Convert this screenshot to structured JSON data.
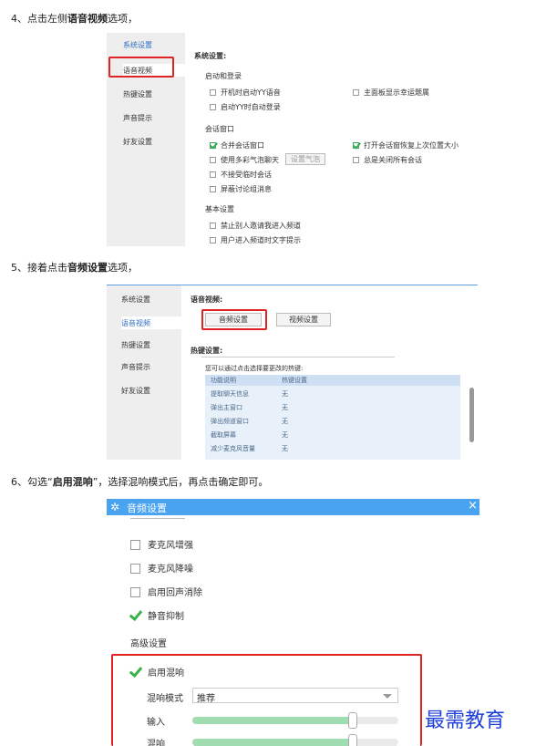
{
  "steps": [
    {
      "prefix": "4、点击左侧",
      "bold": "语音视频",
      "suffix": "选项，"
    },
    {
      "prefix": "5、接着点击",
      "bold": "音频设置",
      "suffix": "选项，"
    },
    {
      "prefix": "6、勾选“",
      "bold": "启用混响",
      "suffix": "”，选择混响模式后，再点击确定即可。"
    }
  ],
  "shot1": {
    "nav": [
      "系统设置",
      "语音视频",
      "热键设置",
      "声音提示",
      "好友设置"
    ],
    "section": "系统设置:",
    "startup_title": "启动和登录",
    "startup_left": [
      {
        "label": "开机时启动YY语音",
        "checked": false
      },
      {
        "label": "启动YY时自动登录",
        "checked": false
      }
    ],
    "startup_right": {
      "label": "主面板显示幸运题属",
      "checked": false
    },
    "session_title": "会话窗口",
    "session_left": [
      {
        "label": "合并会话窗口",
        "checked": true
      },
      {
        "label": "使用多彩气泡聊天",
        "checked": false
      },
      {
        "label": "不接受临时会话",
        "checked": false
      },
      {
        "label": "屏蔽讨论组消息",
        "checked": false
      }
    ],
    "bubble_button": "设置气泡",
    "session_right": [
      {
        "label": "打开会话窗恢复上次位置大小",
        "checked": true
      },
      {
        "label": "总是关闭所有会话",
        "checked": false
      }
    ],
    "basic_title": "基本设置",
    "basic": [
      {
        "label": "禁止别人邀请我进入频道",
        "checked": false
      },
      {
        "label": "用户进入频道时文字提示",
        "checked": false
      }
    ]
  },
  "shot2": {
    "nav": [
      "系统设置",
      "语音视频",
      "热键设置",
      "声音提示",
      "好友设置"
    ],
    "section": "语音视频:",
    "audio_button": "音频设置",
    "video_button": "视频设置",
    "hotkey_title": "热键设置:",
    "hotkey_hint": "您可以通过点击选择要更改的热键:",
    "table_header": [
      "功能说明",
      "热键设置"
    ],
    "rows": [
      [
        "提取聊天信息",
        "无"
      ],
      [
        "弹出主窗口",
        "无"
      ],
      [
        "弹出频道窗口",
        "无"
      ],
      [
        "截取屏幕",
        "无"
      ],
      [
        "减少麦克风音量",
        "无"
      ]
    ]
  },
  "shot3": {
    "title": "音频设置",
    "close": "×",
    "options": [
      {
        "label": "麦克风增强",
        "checked": false
      },
      {
        "label": "麦克风降噪",
        "checked": false
      },
      {
        "label": "启用回声消除",
        "checked": false
      },
      {
        "label": "静音抑制",
        "checked": true
      }
    ],
    "advanced_title": "高级设置",
    "reverb": {
      "label": "启用混响",
      "checked": true
    },
    "mode_label": "混响模式",
    "mode_value": "推荐",
    "input_label": "输入",
    "input_level": 0.78,
    "reverb_label": "混响",
    "reverb_level": 0.78
  },
  "watermark": "最需教育"
}
